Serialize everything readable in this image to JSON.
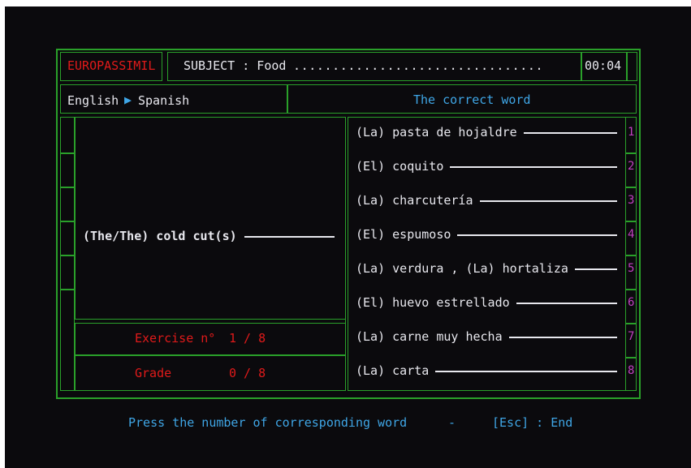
{
  "header": {
    "app_name": "EUROPASSIMIL",
    "subject_label": "SUBJECT : Food",
    "subject_dots": "................................",
    "timer": "00:04"
  },
  "lang": {
    "from": "English",
    "to": "Spanish"
  },
  "right_header": "The correct word",
  "prompt_word": "(The/The) cold cut(s)",
  "exercise": {
    "label": "Exercise n°",
    "value": "1 / 8"
  },
  "grade": {
    "label": "Grade",
    "value": "0 / 8"
  },
  "options": [
    {
      "text": "(La) pasta de hojaldre",
      "num": "1"
    },
    {
      "text": "(El) coquito",
      "num": "2"
    },
    {
      "text": "(La) charcutería",
      "num": "3"
    },
    {
      "text": "(El) espumoso",
      "num": "4"
    },
    {
      "text": "(La) verdura , (La) hortaliza",
      "num": "5"
    },
    {
      "text": "(El) huevo estrellado",
      "num": "6"
    },
    {
      "text": "(La) carne muy hecha",
      "num": "7"
    },
    {
      "text": "(La) carta",
      "num": "8"
    }
  ],
  "footer": {
    "instruction": "Press the number of corresponding word",
    "dash": "-",
    "esc": "[Esc] : End"
  },
  "colors": {
    "border": "#2aa02a",
    "text": "#e8e8ee",
    "red": "#e01a1a",
    "cyan": "#3fa6e6",
    "magenta": "#c040c0"
  }
}
